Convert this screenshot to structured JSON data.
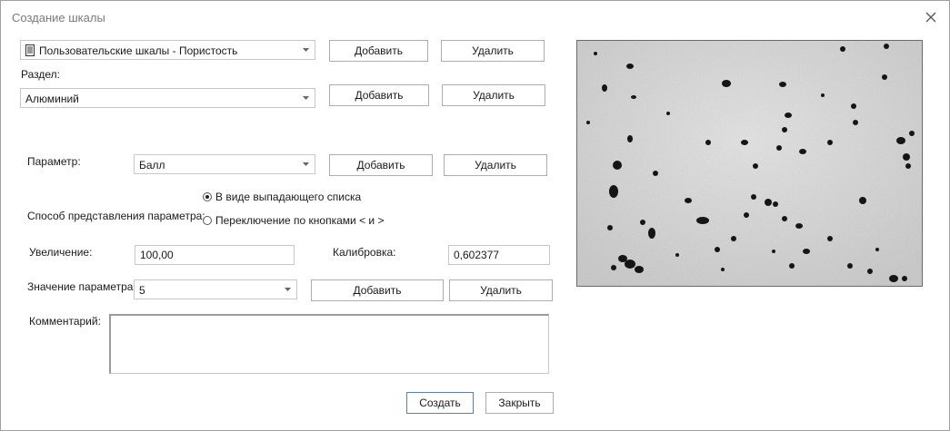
{
  "window": {
    "title": "Создание шкалы"
  },
  "scale_select": {
    "value": "Пользовательские шкалы - Пористость"
  },
  "scale_actions": {
    "add_label": "Добавить",
    "delete_label": "Удалить"
  },
  "section": {
    "label": "Раздел:",
    "value": "Алюминий",
    "add_label": "Добавить",
    "delete_label": "Удалить"
  },
  "parameter": {
    "label": "Параметр:",
    "value": "Балл",
    "add_label": "Добавить",
    "delete_label": "Удалить"
  },
  "representation": {
    "label": "Способ представления параметра:",
    "options": [
      {
        "label": "В виде выпадающего списка",
        "selected": true
      },
      {
        "label": "Переключение по кнопками < и >",
        "selected": false
      }
    ]
  },
  "magnification": {
    "label": "Увеличение:",
    "value": "100,00"
  },
  "calibration": {
    "label": "Калибровка:",
    "value": "0,602377"
  },
  "param_value": {
    "label": "Значение параметра:",
    "value": "5",
    "add_label": "Добавить",
    "delete_label": "Удалить"
  },
  "comment": {
    "label": "Комментарий:",
    "value": ""
  },
  "footer": {
    "create_label": "Создать",
    "close_label": "Закрыть"
  },
  "colors": {
    "primary_border": "#5a7fb3",
    "border": "#adadad",
    "title_text": "#7a7a7a"
  },
  "icons": {
    "close": "close-icon",
    "scale": "document-icon",
    "chevron": "chevron-down-icon"
  }
}
